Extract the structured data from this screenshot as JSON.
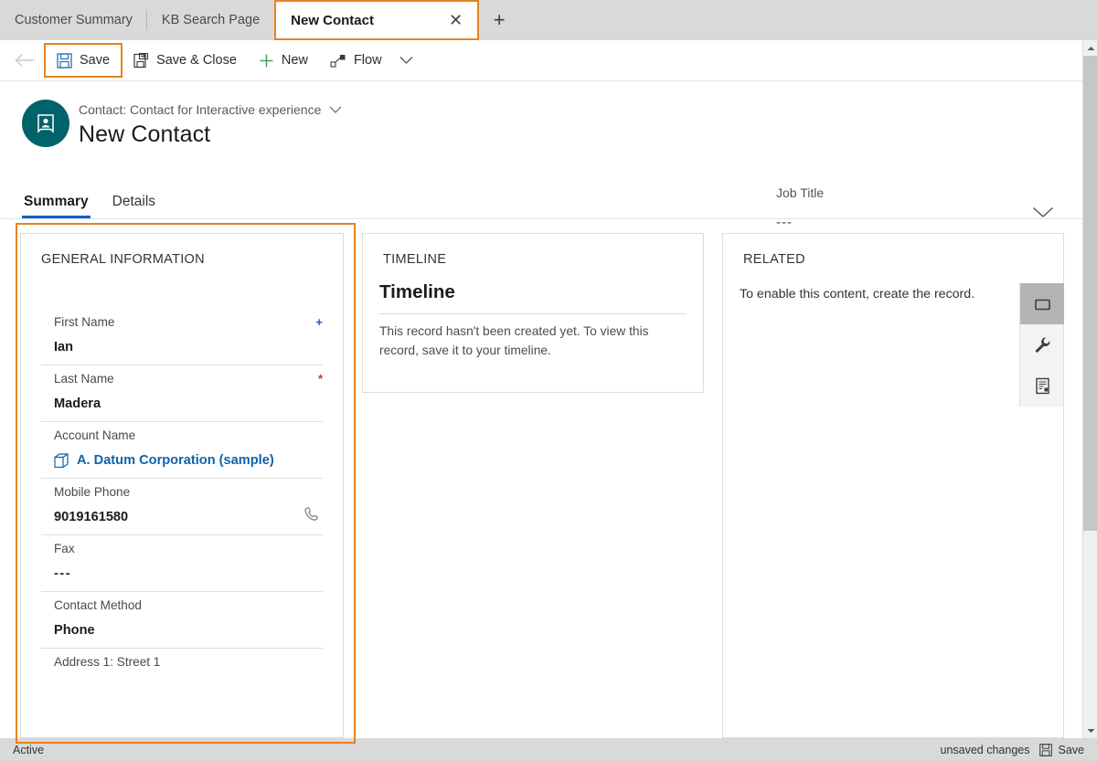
{
  "tabs": {
    "items": [
      {
        "label": "Customer Summary",
        "active": false
      },
      {
        "label": "KB Search Page",
        "active": false
      },
      {
        "label": "New Contact",
        "active": true
      }
    ],
    "close_glyph": "✕",
    "new_tab_glyph": "+"
  },
  "commandbar": {
    "back_glyph": "←",
    "save_label": "Save",
    "save_close_label": "Save & Close",
    "new_label": "New",
    "flow_label": "Flow",
    "overflow_glyph": "⌄"
  },
  "record": {
    "entity_line": "Contact: Contact for Interactive experience",
    "title": "New Contact",
    "header_field_label": "Job Title",
    "header_field_value": "---"
  },
  "form_tabs": [
    {
      "label": "Summary",
      "selected": true
    },
    {
      "label": "Details",
      "selected": false
    }
  ],
  "general": {
    "title": "GENERAL INFORMATION",
    "fields": [
      {
        "label": "First Name",
        "value": "Ian",
        "required": "+",
        "kind": "text"
      },
      {
        "label": "Last Name",
        "value": "Madera",
        "required": "*",
        "kind": "text"
      },
      {
        "label": "Account Name",
        "value": "A. Datum Corporation (sample)",
        "required": "",
        "kind": "lookup"
      },
      {
        "label": "Mobile Phone",
        "value": "9019161580",
        "required": "",
        "kind": "phone"
      },
      {
        "label": "Fax",
        "value": "---",
        "required": "",
        "kind": "empty"
      },
      {
        "label": "Contact Method",
        "value": "Phone",
        "required": "",
        "kind": "text"
      },
      {
        "label": "Address 1: Street 1",
        "value": "",
        "required": "",
        "kind": "text"
      }
    ]
  },
  "timeline": {
    "title": "TIMELINE",
    "heading": "Timeline",
    "message": "This record hasn't been created yet.  To view this record, save it to your timeline."
  },
  "related": {
    "title": "RELATED",
    "message": "To enable this content, create the record.",
    "rail_icons": [
      {
        "name": "folder-icon",
        "selected": true
      },
      {
        "name": "wrench-icon",
        "selected": false
      },
      {
        "name": "document-icon",
        "selected": false
      }
    ]
  },
  "statusbar": {
    "state": "Active",
    "unsaved": "unsaved changes",
    "save_label": "Save"
  },
  "colors": {
    "highlight": "#e8821e",
    "accent": "#0f62c9",
    "avatar": "#00626b",
    "link": "#1062ab",
    "required": "#d93025",
    "recommended": "#2a54c7"
  }
}
